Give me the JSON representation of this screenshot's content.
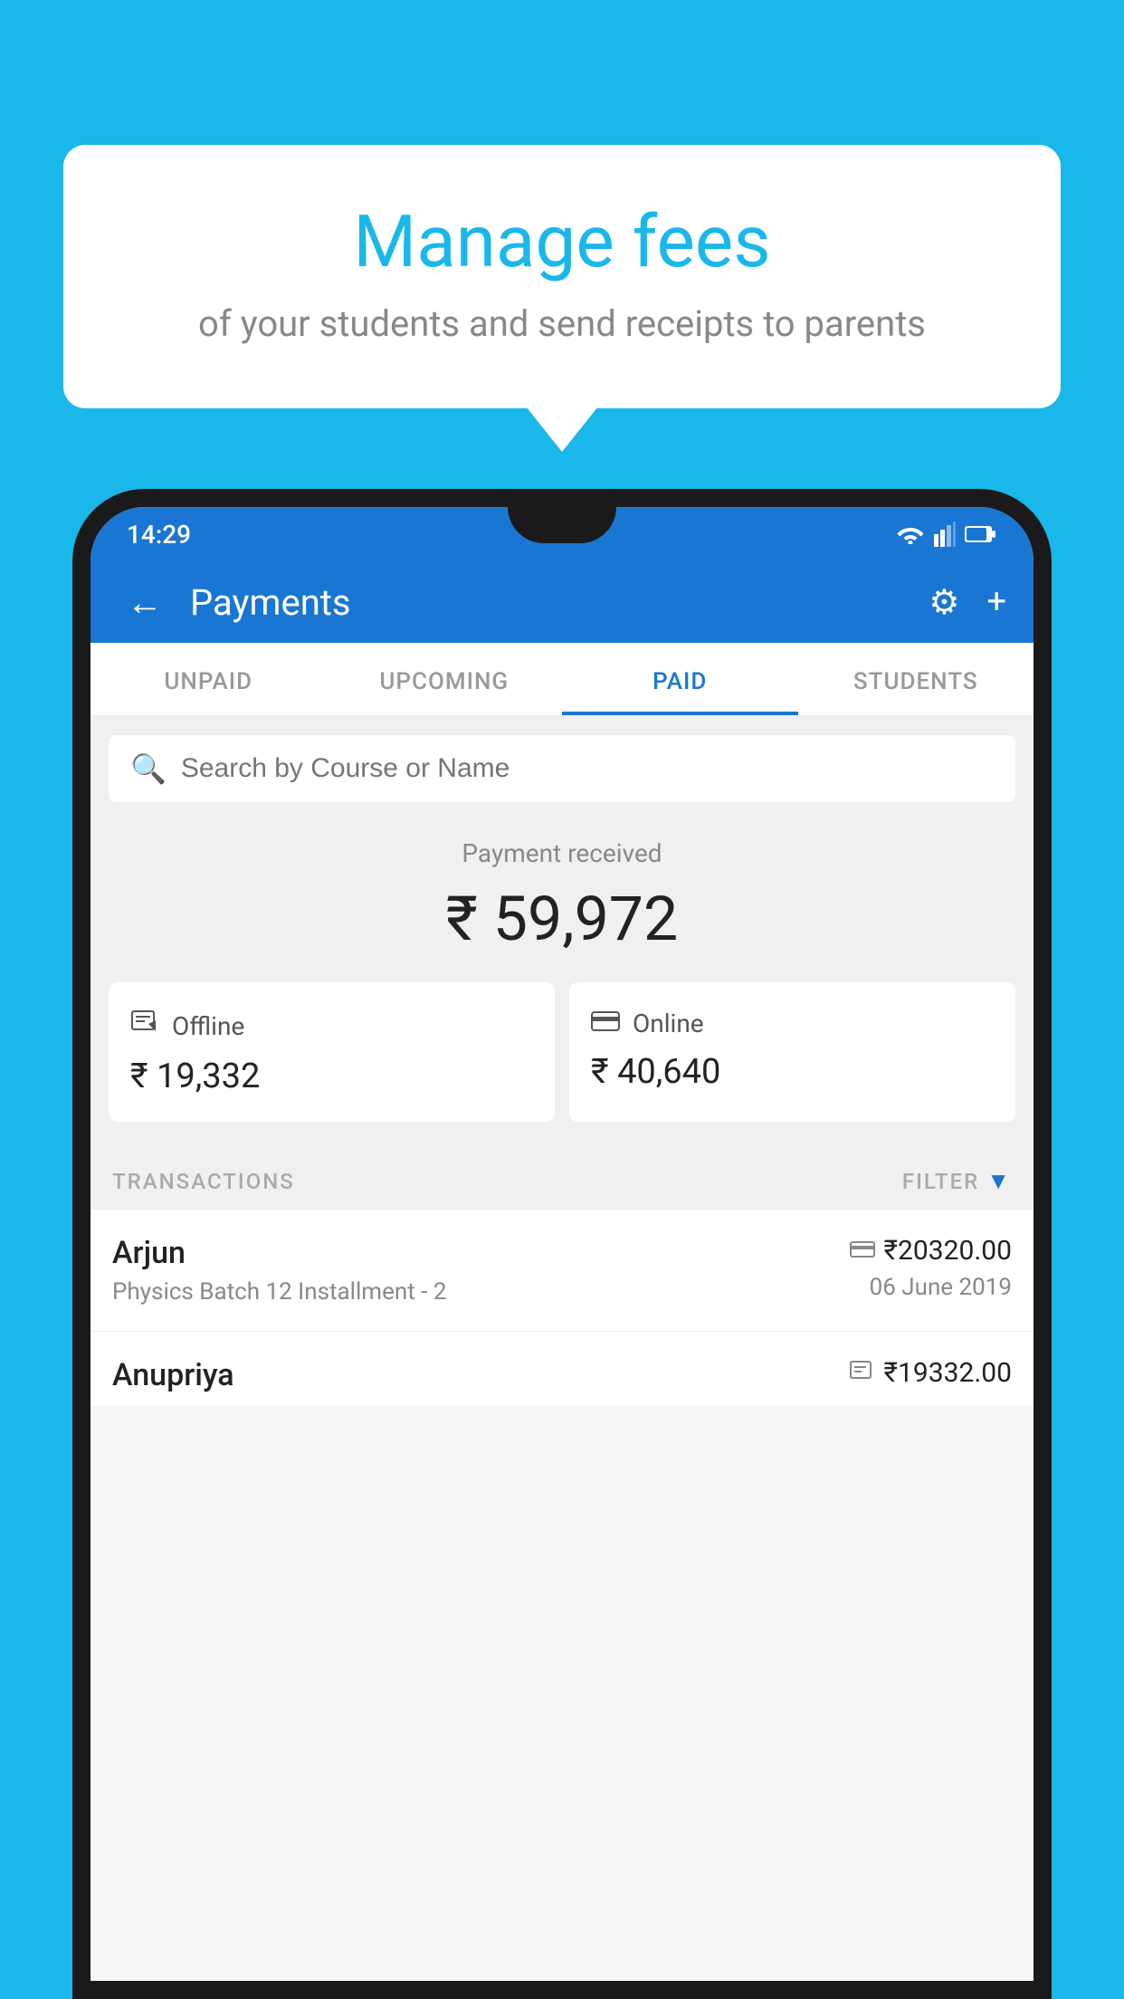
{
  "page": {
    "background_color": "#1ab7ea"
  },
  "bubble": {
    "title": "Manage fees",
    "subtitle": "of your students and send receipts to parents"
  },
  "status_bar": {
    "time": "14:29"
  },
  "app_bar": {
    "title": "Payments",
    "back_label": "←",
    "settings_label": "⚙",
    "add_label": "+"
  },
  "tabs": [
    {
      "label": "UNPAID",
      "active": false
    },
    {
      "label": "UPCOMING",
      "active": false
    },
    {
      "label": "PAID",
      "active": true
    },
    {
      "label": "STUDENTS",
      "active": false
    }
  ],
  "search": {
    "placeholder": "Search by Course or Name"
  },
  "payment_summary": {
    "label": "Payment received",
    "amount": "₹ 59,972",
    "offline_label": "Offline",
    "offline_amount": "₹ 19,332",
    "online_label": "Online",
    "online_amount": "₹ 40,640"
  },
  "transactions": {
    "section_label": "TRANSACTIONS",
    "filter_label": "FILTER",
    "rows": [
      {
        "name": "Arjun",
        "course": "Physics Batch 12 Installment - 2",
        "pay_icon": "card",
        "amount": "₹20320.00",
        "date": "06 June 2019"
      },
      {
        "name": "Anupriya",
        "course": "",
        "pay_icon": "offline",
        "amount": "₹19332.00",
        "date": ""
      }
    ]
  }
}
